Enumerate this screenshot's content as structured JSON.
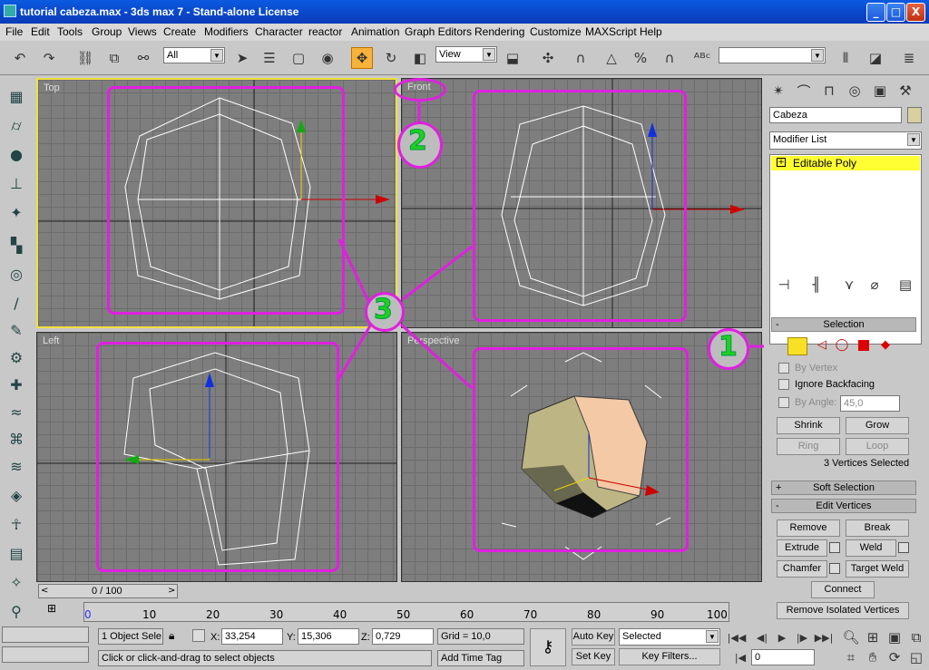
{
  "window": {
    "title": "tutorial cabeza.max - 3ds max 7  - Stand-alone License",
    "min": "_",
    "max": "□",
    "close": "X"
  },
  "menu": [
    "File",
    "Edit",
    "Tools",
    "Group",
    "Views",
    "Create",
    "Modifiers",
    "Character",
    "reactor",
    "Animation",
    "Graph Editors",
    "Rendering",
    "Customize",
    "MAXScript",
    "Help"
  ],
  "toolbar": {
    "selection_filter": "All",
    "ref_coord": "View",
    "named_selection": ""
  },
  "viewports": {
    "top": "Top",
    "front": "Front",
    "left": "Left",
    "perspective": "Perspective"
  },
  "command_panel": {
    "object_name": "Cabeza",
    "modifier_list": "Modifier List",
    "stack_item": "Editable Poly",
    "selection": {
      "title": "Selection",
      "by_vertex": "By Vertex",
      "ignore_backfacing": "Ignore Backfacing",
      "by_angle": "By Angle:",
      "angle_value": "45,0",
      "shrink": "Shrink",
      "grow": "Grow",
      "ring": "Ring",
      "loop": "Loop",
      "status": "3 Vertices Selected"
    },
    "soft_selection": "Soft Selection",
    "edit_vertices": {
      "title": "Edit Vertices",
      "remove": "Remove",
      "break": "Break",
      "extrude": "Extrude",
      "weld": "Weld",
      "chamfer": "Chamfer",
      "target_weld": "Target Weld",
      "connect": "Connect",
      "remove_isolated": "Remove Isolated Vertices"
    }
  },
  "timeline": {
    "slider": "0 / 100",
    "ticks": [
      "0",
      "10",
      "20",
      "30",
      "40",
      "50",
      "60",
      "70",
      "80",
      "90",
      "100"
    ]
  },
  "status": {
    "objects": "1 Object Sele",
    "x_label": "X:",
    "x": "33,254",
    "y_label": "Y:",
    "y": "15,306",
    "z_label": "Z:",
    "z": "0,729",
    "grid": "Grid = 10,0",
    "auto_key": "Auto Key",
    "key_mode": "Selected",
    "set_key": "Set Key",
    "key_filters": "Key Filters...",
    "frame": "0",
    "prompt": "Click or click-and-drag to select objects",
    "add_time_tag": "Add Time Tag"
  },
  "annotations": {
    "one": "1",
    "two": "2",
    "three": "3"
  },
  "colors": {
    "annotation": "#e020e0",
    "annotation_number": "#1fd01f",
    "active_viewport": "#f0e040",
    "stack_highlight": "#ffff33"
  }
}
